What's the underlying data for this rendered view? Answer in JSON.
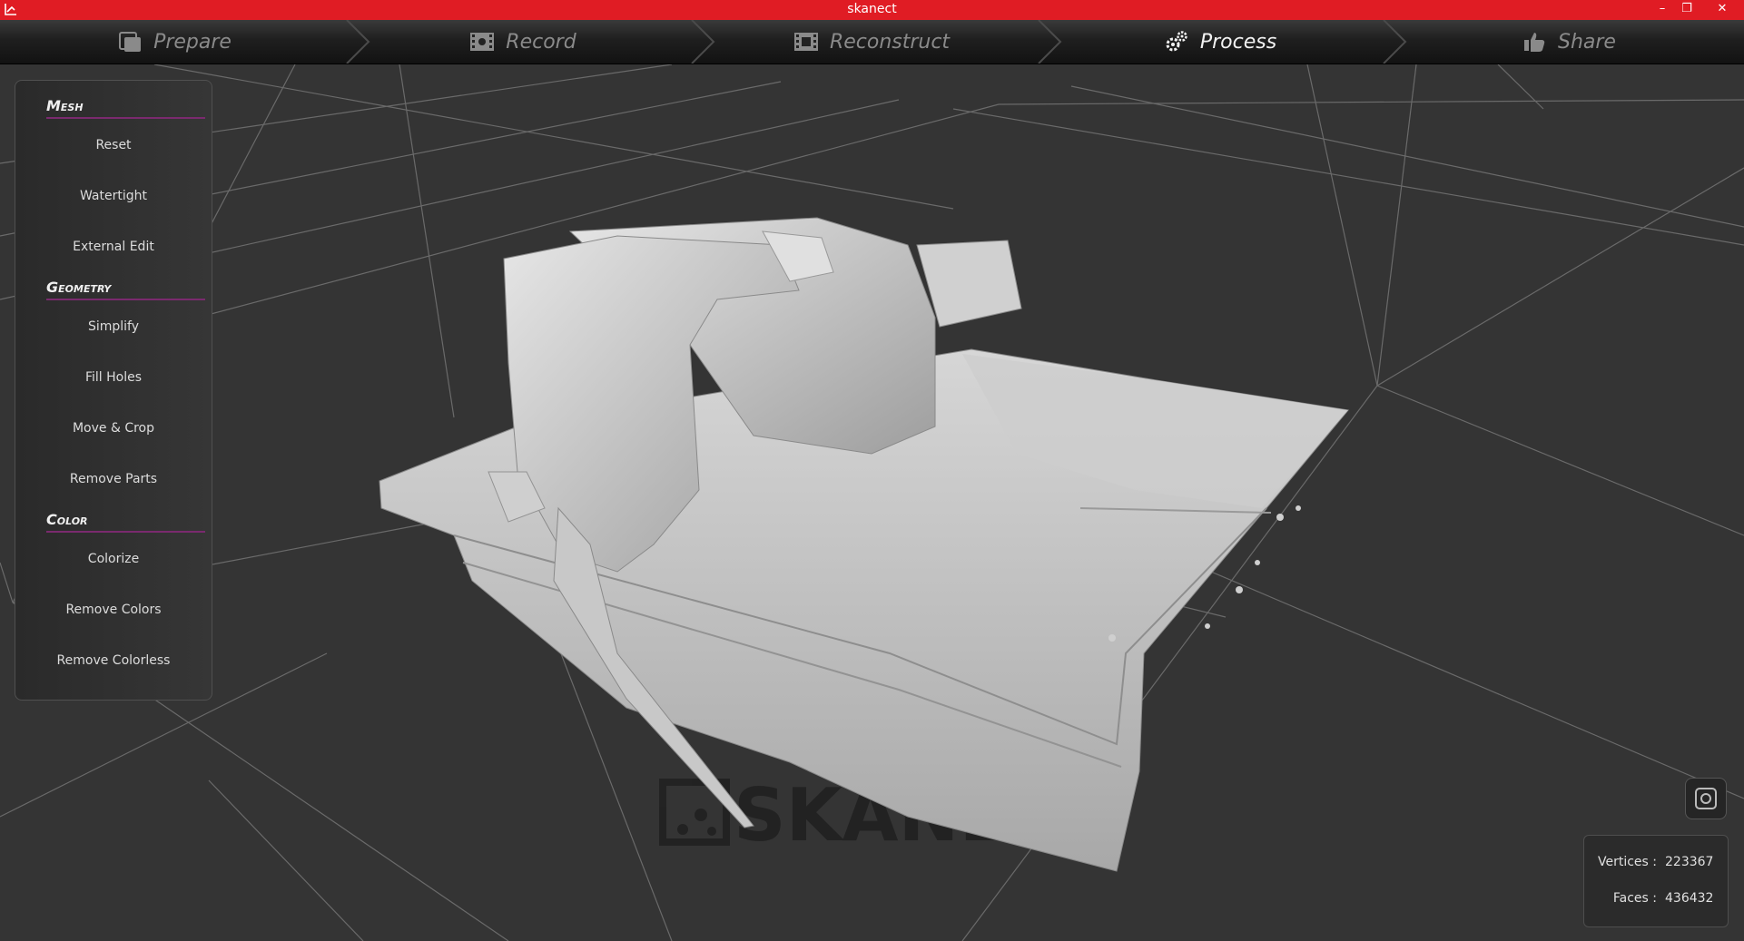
{
  "window": {
    "title": "skanect",
    "app_icon": "skanect-logo-icon",
    "accent": "#e01c24"
  },
  "window_controls": [
    "minimize-icon",
    "restore-icon",
    "close-icon"
  ],
  "tabs": [
    {
      "label": "Prepare",
      "icon": "prepare-icon",
      "active": false
    },
    {
      "label": "Record",
      "icon": "record-film-icon",
      "active": false
    },
    {
      "label": "Reconstruct",
      "icon": "reconstruct-film-icon",
      "active": false
    },
    {
      "label": "Process",
      "icon": "gears-icon",
      "active": true
    },
    {
      "label": "Share",
      "icon": "thumbs-up-icon",
      "active": false
    }
  ],
  "panel": {
    "sections": [
      {
        "title": "Mesh",
        "items": [
          "Reset",
          "Watertight",
          "External Edit"
        ]
      },
      {
        "title": "Geometry",
        "items": [
          "Simplify",
          "Fill Holes",
          "Move & Crop",
          "Remove Parts"
        ]
      },
      {
        "title": "Color",
        "items": [
          "Colorize",
          "Remove Colors",
          "Remove Colorless"
        ]
      }
    ]
  },
  "stats": {
    "vertices_label": "Vertices :",
    "vertices": "223367",
    "faces_label": "Faces :",
    "faces": "436432"
  },
  "watermark": "SKANECT",
  "camera_button_icon": "camera-view-icon"
}
